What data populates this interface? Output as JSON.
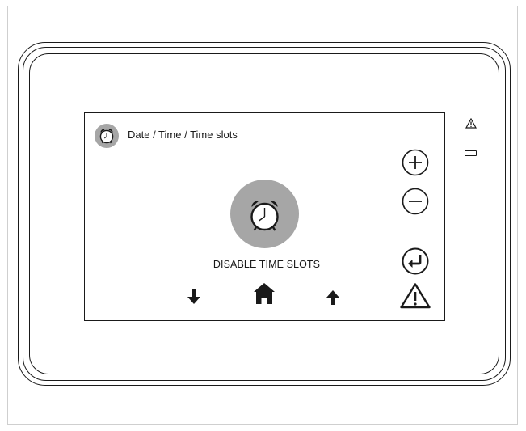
{
  "screen": {
    "header": {
      "title": "Date / Time / Time slots",
      "icon": "alarm-clock-icon"
    },
    "main": {
      "icon": "alarm-clock-icon",
      "action_label": "DISABLE TIME SLOTS"
    },
    "right_controls": [
      {
        "name": "plus-icon"
      },
      {
        "name": "minus-icon"
      },
      {
        "name": "enter-return-icon"
      },
      {
        "name": "warning-icon"
      }
    ],
    "bottom_nav": [
      {
        "name": "arrow-down-icon"
      },
      {
        "name": "home-icon"
      },
      {
        "name": "arrow-up-icon"
      }
    ]
  },
  "device": {
    "indicators": [
      "warning-led",
      "status-led-bar"
    ]
  },
  "colors": {
    "icon_background": "#a6a6a6",
    "foreground": "#1a1a1a"
  }
}
